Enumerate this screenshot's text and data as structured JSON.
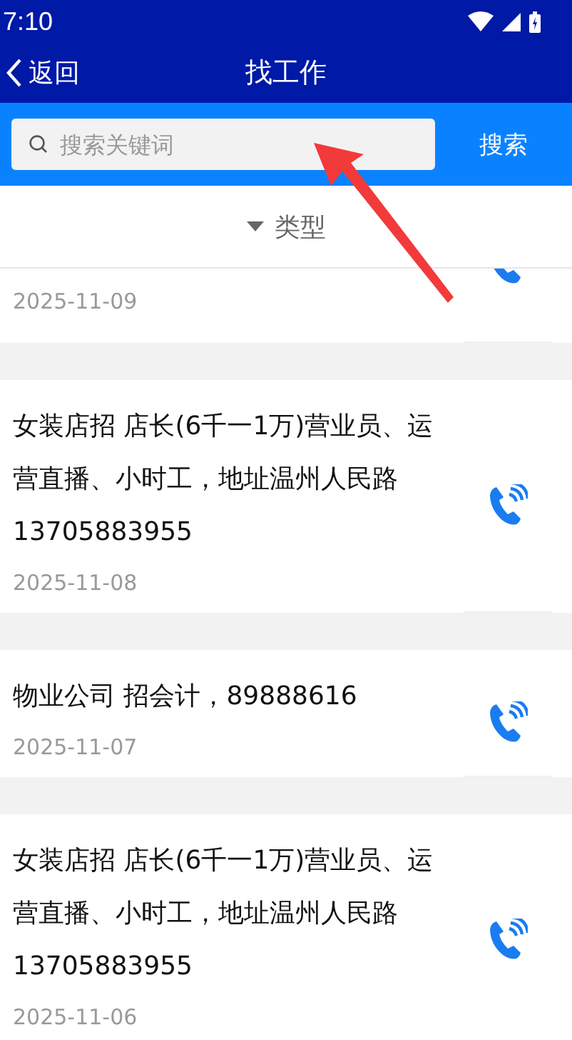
{
  "status_bar": {
    "time": "7:10"
  },
  "nav": {
    "back": "返回",
    "title": "找工作"
  },
  "search": {
    "placeholder": "搜索关键词",
    "button": "搜索"
  },
  "filter": {
    "label": "类型"
  },
  "jobs": [
    {
      "kind": "cut",
      "date": "2025-11-09"
    },
    {
      "kind": "full",
      "text": "女装店招 店长(6千一1万)营业员、运营直播、小时工，地址温州人民路13705883955",
      "date": "2025-11-08"
    },
    {
      "kind": "full",
      "text": "物业公司 招会计，89888616",
      "date": "2025-11-07"
    },
    {
      "kind": "full",
      "text": "女装店招 店长(6千一1万)营业员、运营直播、小时工，地址温州人民路13705883955",
      "date": "2025-11-06"
    }
  ]
}
